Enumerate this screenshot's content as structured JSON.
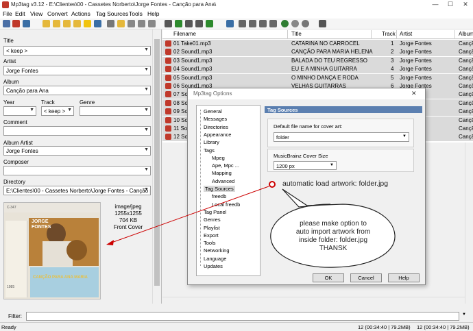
{
  "window": {
    "title": "Mp3tag v3.12  - E:\\Clientes\\00 - Cassetes Norberto\\Jorge Fontes - Canção para Ana\\",
    "minimize": "—",
    "maximize": "☐",
    "close": "✕"
  },
  "menu": [
    "File",
    "Edit",
    "View",
    "Convert",
    "Actions",
    "Tag Sources",
    "Tools",
    "Help"
  ],
  "fields": {
    "title_label": "Title",
    "title_value": "< keep >",
    "artist_label": "Artist",
    "artist_value": "Jorge Fontes",
    "album_label": "Album",
    "album_value": "Canção para Ana",
    "year_label": "Year",
    "track_label": "Track",
    "track_value": "< keep >",
    "genre_label": "Genre",
    "comment_label": "Comment",
    "album_artist_label": "Album Artist",
    "album_artist_value": "Jorge Fontes",
    "composer_label": "Composer",
    "directory_label": "Directory",
    "directory_value": "E:\\Clientes\\00 - Cassetes Norberto\\Jorge Fontes - Canção p"
  },
  "cover": {
    "mime": "image/jpeg",
    "dimensions": "1255x1255",
    "size": "704 KB",
    "type": "Front Cover",
    "artist_text": "JORGE FONTES",
    "album_text": "CANÇÃO PARA ANA MARIA",
    "catalog": "C-347",
    "year": "1985"
  },
  "list": {
    "columns": [
      "Filename",
      "Title",
      "Track",
      "Artist",
      "Album"
    ],
    "rows": [
      {
        "filename": "01 Take01.mp3",
        "title": "CATARINA NO CARROCEL",
        "track": "1",
        "artist": "Jorge Fontes",
        "album": "Canção"
      },
      {
        "filename": "02 Sound1.mp3",
        "title": "CANÇÃO PARA MARIA HELENA",
        "track": "2",
        "artist": "Jorge Fontes",
        "album": "Canção"
      },
      {
        "filename": "03 Sound1.mp3",
        "title": "BALADA DO TEU REGRESSO",
        "track": "3",
        "artist": "Jorge Fontes",
        "album": "Canção"
      },
      {
        "filename": "04 Sound1.mp3",
        "title": "EU E A MINHA GUITARRA",
        "track": "4",
        "artist": "Jorge Fontes",
        "album": "Canção"
      },
      {
        "filename": "05 Sound1.mp3",
        "title": "O MINHO DANÇA E RODA",
        "track": "5",
        "artist": "Jorge Fontes",
        "album": "Canção"
      },
      {
        "filename": "06 Sound1.mp3",
        "title": "VELHAS GUITARRAS",
        "track": "6",
        "artist": "Jorge Fontes",
        "album": "Canção"
      },
      {
        "filename": "07 Sound1.mp3",
        "title": "",
        "track": "",
        "artist": "",
        "album": "Canção"
      },
      {
        "filename": "08 Sound1.mp3",
        "title": "",
        "track": "",
        "artist": "",
        "album": "Canção"
      },
      {
        "filename": "09 Sound1.mp3",
        "title": "",
        "track": "",
        "artist": "",
        "album": "Canção"
      },
      {
        "filename": "10 Sound1.mp3",
        "title": "",
        "track": "",
        "artist": "",
        "album": "Canção"
      },
      {
        "filename": "11 Sound1.mp3",
        "title": "",
        "track": "",
        "artist": "",
        "album": "Canção"
      },
      {
        "filename": "12 Sound1.mp3",
        "title": "",
        "track": "",
        "artist": "",
        "album": "Canção"
      }
    ]
  },
  "dialog": {
    "title": "Mp3tag Options",
    "close": "✕",
    "tree": [
      {
        "label": "General",
        "indent": 0,
        "selected": false
      },
      {
        "label": "Messages",
        "indent": 0,
        "selected": false
      },
      {
        "label": "Directories",
        "indent": 0,
        "selected": false
      },
      {
        "label": "Appearance",
        "indent": 0,
        "selected": false
      },
      {
        "label": "Library",
        "indent": 0,
        "selected": false
      },
      {
        "label": "Tags",
        "indent": 0,
        "selected": false
      },
      {
        "label": "Mpeg",
        "indent": 1,
        "selected": false
      },
      {
        "label": "Ape, Mpc ...",
        "indent": 1,
        "selected": false
      },
      {
        "label": "Mapping",
        "indent": 1,
        "selected": false
      },
      {
        "label": "Advanced",
        "indent": 1,
        "selected": false
      },
      {
        "label": "Tag Sources",
        "indent": 0,
        "selected": true
      },
      {
        "label": "freedb",
        "indent": 1,
        "selected": false
      },
      {
        "label": "Local freedb",
        "indent": 1,
        "selected": false
      },
      {
        "label": "Tag Panel",
        "indent": 0,
        "selected": false
      },
      {
        "label": "Genres",
        "indent": 0,
        "selected": false
      },
      {
        "label": "Playlist",
        "indent": 0,
        "selected": false
      },
      {
        "label": "Export",
        "indent": 0,
        "selected": false
      },
      {
        "label": "Tools",
        "indent": 0,
        "selected": false
      },
      {
        "label": "Networking",
        "indent": 0,
        "selected": false
      },
      {
        "label": "Language",
        "indent": 0,
        "selected": false
      },
      {
        "label": "Updates",
        "indent": 0,
        "selected": false
      }
    ],
    "section_title": "Tag Sources",
    "cover_label": "Default file name for cover art:",
    "cover_value": "folder",
    "mb_label": "MusicBrainz Cover Size",
    "mb_value": "1200 px",
    "ok": "OK",
    "cancel": "Cancel",
    "help": "Help"
  },
  "annotation": {
    "radio_text": "automatic load artwork: folder.jpg",
    "bubble_text_1": "please make option to",
    "bubble_text_2": "auto import artwork from",
    "bubble_text_3": "inside folder: folder.jpg",
    "bubble_text_4": "THANSK"
  },
  "filter": {
    "label": "Filter:",
    "value": ""
  },
  "status": {
    "left": "Ready",
    "mid": "12 (00:34:40 | 79.2MB)",
    "right": "12 (00:34:40 | 79.2MB)"
  },
  "colors": {
    "accent": "#5b7fb0",
    "selection": "#dadada",
    "annotation": "#cc0000"
  }
}
